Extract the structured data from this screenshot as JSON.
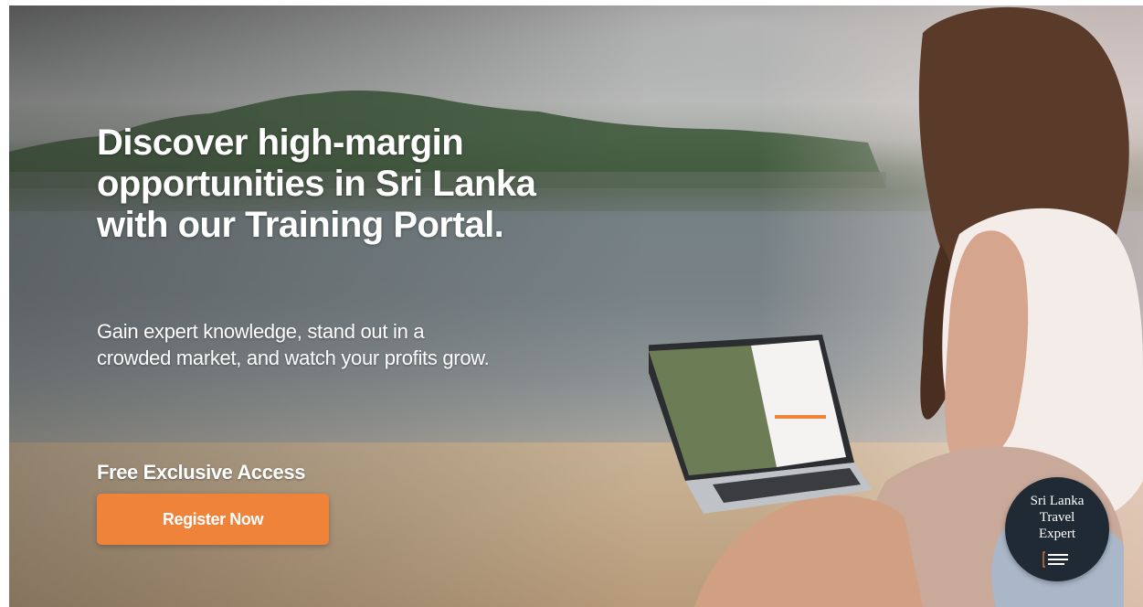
{
  "hero": {
    "headline": "Discover high-margin opportunities in Sri Lanka with our Training Portal.",
    "subtext": "Gain expert knowledge, stand out in a crowded market, and watch your profits grow.",
    "access_label": "Free Exclusive Access",
    "register_label": "Register Now"
  },
  "badge": {
    "line1": "Sri Lanka",
    "line2": "Travel",
    "line3": "Expert",
    "logo_icon": "sri-lanka-tourism-alliance-logo"
  },
  "colors": {
    "accent": "#f0833a",
    "badge_bg": "#1f2a35"
  }
}
